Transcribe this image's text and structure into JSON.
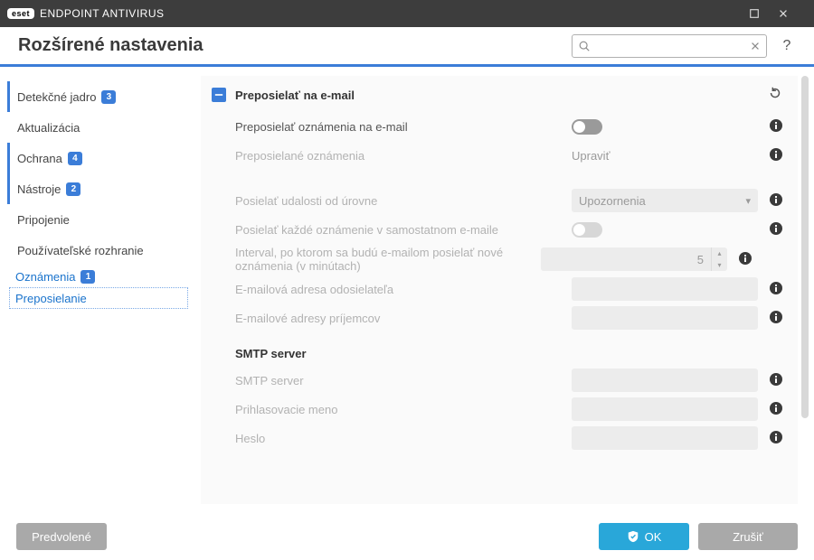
{
  "titlebar": {
    "brand_badge": "eset",
    "product_name": "ENDPOINT ANTIVIRUS"
  },
  "header": {
    "title": "Rozšírené nastavenia",
    "search_placeholder": "",
    "help": "?"
  },
  "sidebar": {
    "items": [
      {
        "label": "Detekčné jadro",
        "badge": "3",
        "marked": true
      },
      {
        "label": "Aktualizácia",
        "badge": null,
        "marked": false
      },
      {
        "label": "Ochrana",
        "badge": "4",
        "marked": true
      },
      {
        "label": "Nástroje",
        "badge": "2",
        "marked": true
      },
      {
        "label": "Pripojenie",
        "badge": null,
        "marked": false
      },
      {
        "label": "Používateľské rozhranie",
        "badge": null,
        "marked": false
      }
    ],
    "sub": [
      {
        "label": "Oznámenia",
        "badge": "1",
        "selected": false
      },
      {
        "label": "Preposielanie",
        "badge": null,
        "selected": true
      }
    ]
  },
  "panel": {
    "section_title": "Preposielať na e-mail",
    "rows": {
      "forward_notifications": {
        "label": "Preposielať oznámenia na e-mail"
      },
      "forwarded_notifications": {
        "label": "Preposielané oznámenia",
        "action": "Upraviť"
      },
      "send_from_level": {
        "label": "Posielať udalosti od úrovne",
        "value": "Upozornenia"
      },
      "separate_email": {
        "label": "Posielať každé oznámenie v samostatnom e-maile"
      },
      "interval": {
        "label": "Interval, po ktorom sa budú e-mailom posielať nové oznámenia (v minútach)",
        "value": "5"
      },
      "sender_address": {
        "label": "E-mailová adresa odosielateľa"
      },
      "recipient_addresses": {
        "label": "E-mailové adresy príjemcov"
      }
    },
    "smtp": {
      "title": "SMTP server",
      "server": {
        "label": "SMTP server"
      },
      "username": {
        "label": "Prihlasovacie meno"
      },
      "password": {
        "label": "Heslo"
      }
    }
  },
  "footer": {
    "defaults": "Predvolené",
    "ok": "OK",
    "cancel": "Zrušiť"
  }
}
